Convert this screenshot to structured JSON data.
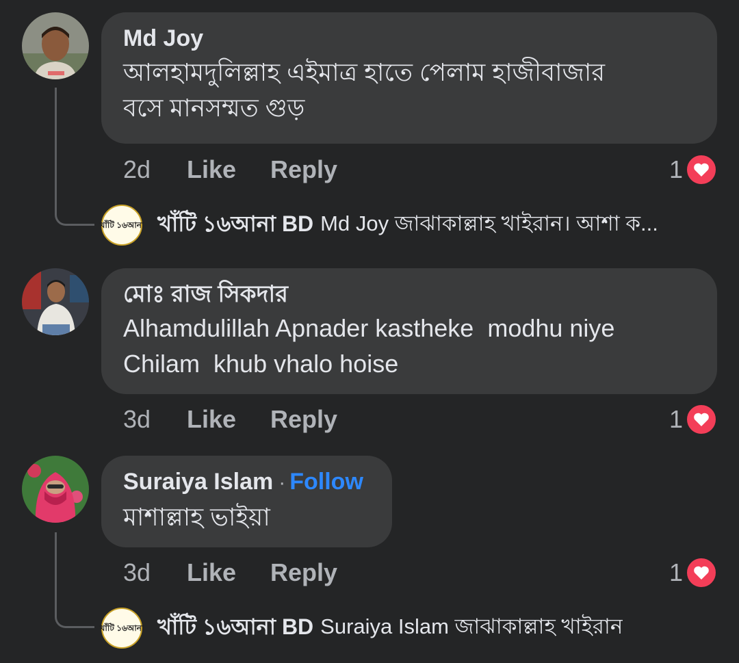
{
  "comments": [
    {
      "author": "Md Joy",
      "text": "আলহামদুলিল্লাহ এইমাত্র হাতে পেলাম হাজীবাজার\nবসে মানসম্মত গুড়",
      "time": "2d",
      "like_label": "Like",
      "reply_label": "Reply",
      "reaction_count": "1",
      "reaction": "heart-icon",
      "reply": {
        "author": "খাঁটি ১৬আনা BD",
        "text": "Md Joy জাঝাকাল্লাহ খাইরান। আশা ক...",
        "avatar_text": "খাঁটি ১৬আনা"
      }
    },
    {
      "author": "মোঃ রাজ সিকদার",
      "text": "Alhamdulillah Apnader kastheke  modhu niye\nChilam  khub vhalo hoise",
      "time": "3d",
      "like_label": "Like",
      "reply_label": "Reply",
      "reaction_count": "1",
      "reaction": "heart-icon"
    },
    {
      "author": "Suraiya Islam",
      "separator": "·",
      "follow_label": "Follow",
      "text": "মাশাল্লাহ ভাইয়া",
      "time": "3d",
      "like_label": "Like",
      "reply_label": "Reply",
      "reaction_count": "1",
      "reaction": "heart-icon",
      "reply": {
        "author": "খাঁটি ১৬আনা BD",
        "text": "Suraiya Islam জাঝাকাল্লাহ খাইরান",
        "avatar_text": "খাঁটি ১৬আনা"
      }
    }
  ],
  "colors": {
    "background": "#242526",
    "bubble": "#3a3b3c",
    "text_primary": "#e4e6eb",
    "text_secondary": "#b0b3b8",
    "follow": "#2d88ff",
    "heart": "#f33e58"
  }
}
